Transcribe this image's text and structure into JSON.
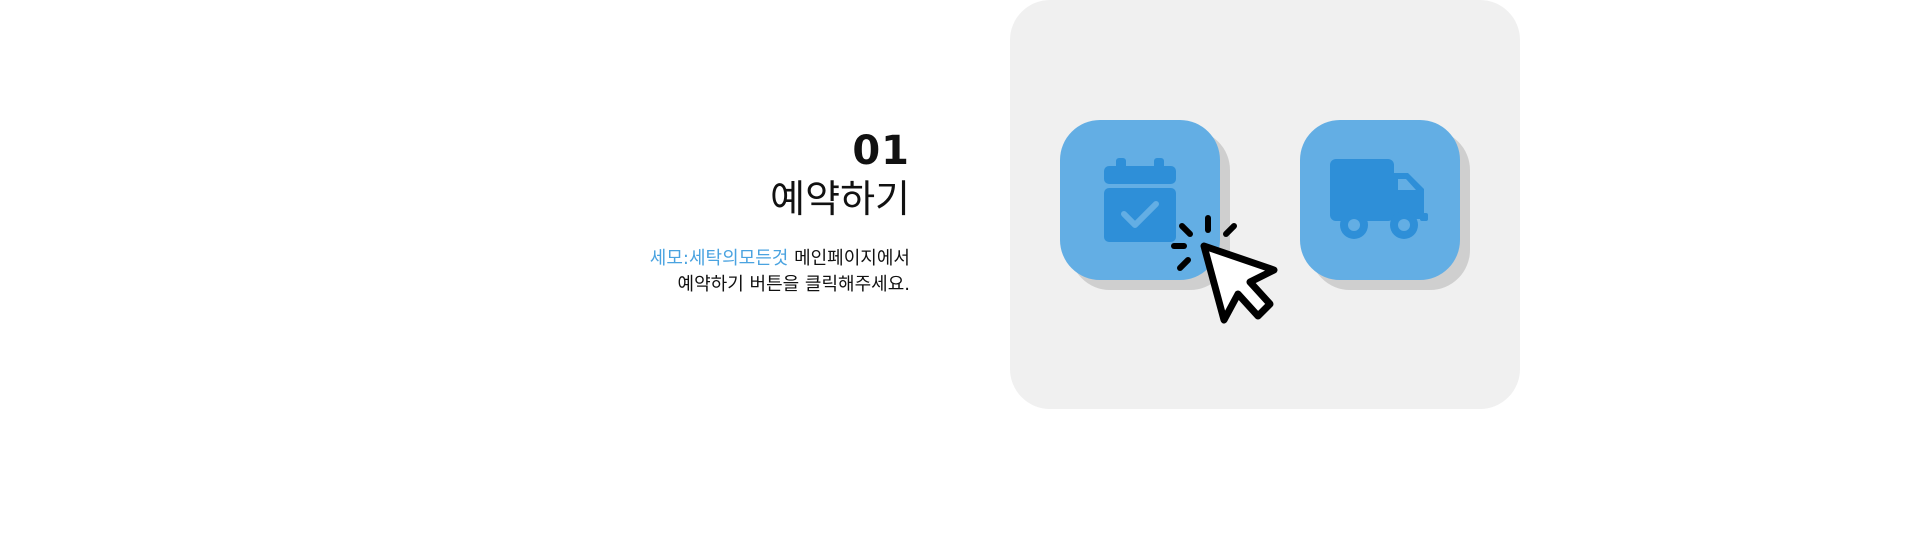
{
  "step": {
    "number": "01",
    "title": "예약하기",
    "brand_name": "세모:세탁의모든것",
    "line1_rest": " 메인페이지에서",
    "line2": "예약하기 버튼을 클릭해주세요."
  },
  "illustration": {
    "buttons": [
      {
        "icon": "calendar-check-icon"
      },
      {
        "icon": "delivery-truck-icon"
      }
    ],
    "cursor_icon": "click-pointer-icon"
  },
  "colors": {
    "accent": "#4aa3e0",
    "tile": "#63aee4",
    "icon": "#2e8fd8",
    "panel": "#f0f0f0",
    "text": "#111111"
  }
}
